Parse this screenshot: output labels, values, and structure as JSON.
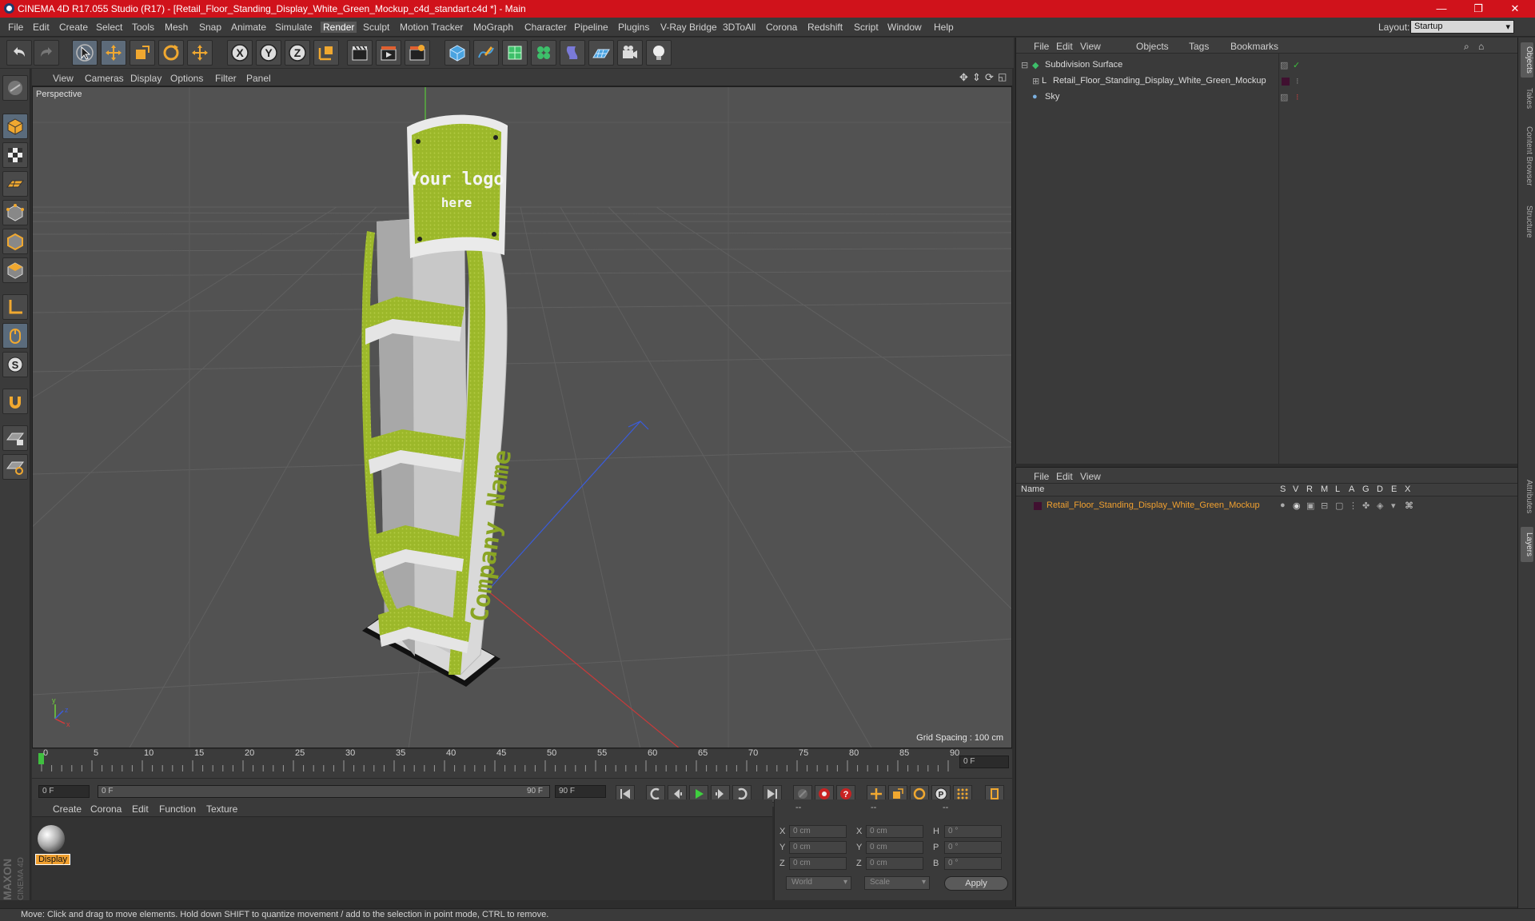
{
  "title": "CINEMA 4D R17.055 Studio (R17) - [Retail_Floor_Standing_Display_White_Green_Mockup_c4d_standart.c4d *] - Main",
  "window_buttons": {
    "minimize": "—",
    "restore": "❐",
    "close": "✕"
  },
  "menu": [
    "File",
    "Edit",
    "Create",
    "Select",
    "Tools",
    "Mesh",
    "Snap",
    "Animate",
    "Simulate",
    "Render",
    "Sculpt",
    "Motion Tracker",
    "MoGraph",
    "Character",
    "Pipeline",
    "Plugins",
    "V-Ray Bridge",
    "3DToAll",
    "Corona",
    "Redshift",
    "Script",
    "Window",
    "Help"
  ],
  "menu_active": "Render",
  "layout": {
    "label": "Layout:",
    "value": "Startup"
  },
  "viewport": {
    "menu": [
      "View",
      "Cameras",
      "Display",
      "Options",
      "Filter",
      "Panel"
    ],
    "label": "Perspective",
    "grid_spacing": "Grid Spacing : 100 cm",
    "model_logo_line1": "Your logo",
    "model_logo_line2": "here",
    "model_side_text": "Company Name"
  },
  "timeline": {
    "ticks": [
      "0",
      "5",
      "10",
      "15",
      "20",
      "25",
      "30",
      "35",
      "40",
      "45",
      "50",
      "55",
      "60",
      "65",
      "70",
      "75",
      "80",
      "85",
      "90"
    ],
    "current_frame": "0 F"
  },
  "playbar": {
    "start": "0 F",
    "range_start": "0 F",
    "range_end": "90 F",
    "end": "90 F"
  },
  "material_panel": {
    "menu": [
      "Create",
      "Corona",
      "Edit",
      "Function",
      "Texture"
    ],
    "material_name": "Display"
  },
  "coords": {
    "header": [
      "--",
      "--",
      "--"
    ],
    "rows": [
      {
        "a": "X",
        "av": "0 cm",
        "b": "X",
        "bv": "0 cm",
        "c": "H",
        "cv": "0 °"
      },
      {
        "a": "Y",
        "av": "0 cm",
        "b": "Y",
        "bv": "0 cm",
        "c": "P",
        "cv": "0 °"
      },
      {
        "a": "Z",
        "av": "0 cm",
        "b": "Z",
        "bv": "0 cm",
        "c": "B",
        "cv": "0 °"
      }
    ],
    "dropdown1": "World",
    "dropdown2": "Scale",
    "apply": "Apply"
  },
  "object_manager": {
    "menu": [
      "File",
      "Edit",
      "View",
      "Objects",
      "Tags",
      "Bookmarks"
    ],
    "objects": [
      "Subdivision Surface",
      "Retail_Floor_Standing_Display_White_Green_Mockup",
      "Sky"
    ]
  },
  "layer_manager": {
    "menu": [
      "File",
      "Edit",
      "View"
    ],
    "name_header": "Name",
    "columns": [
      "S",
      "V",
      "R",
      "M",
      "L",
      "A",
      "G",
      "D",
      "E",
      "X"
    ],
    "layer_name": "Retail_Floor_Standing_Display_White_Green_Mockup"
  },
  "side_tabs": [
    "Objects",
    "Takes",
    "Content Browser",
    "Structure",
    "Attributes",
    "Layers"
  ],
  "status": "Move: Click and drag to move elements. Hold down SHIFT to quantize movement / add to the selection in point mode, CTRL to remove.",
  "maxon_logo": "MAXON CINEMA 4D",
  "colors": {
    "accent_red": "#d0121b",
    "green_accent": "#9cb82a",
    "orange_select": "#f0a030",
    "axis_y": "#6fcf3a",
    "axis_z": "#3a5cdc",
    "axis_x": "#d83a3a"
  }
}
